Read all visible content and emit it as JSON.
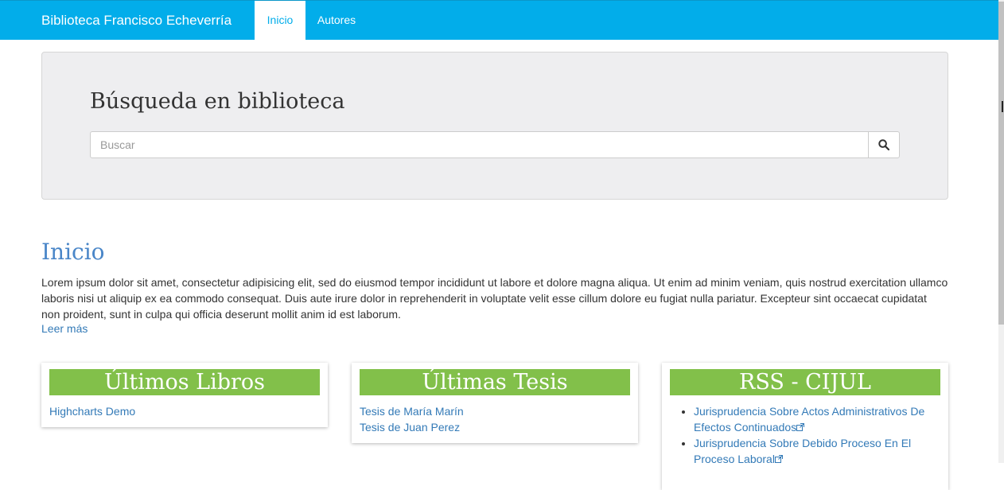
{
  "navbar": {
    "brand": "Biblioteca Francisco Echeverría",
    "items": [
      {
        "label": "Inicio",
        "active": true
      },
      {
        "label": "Autores",
        "active": false
      }
    ],
    "background_color": "#02adea"
  },
  "search": {
    "title": "Búsqueda en biblioteca",
    "placeholder": "Buscar",
    "value": "",
    "button_icon": "search-icon"
  },
  "main": {
    "title": "Inicio",
    "intro": "Lorem ipsum dolor sit amet, consectetur adipisicing elit, sed do eiusmod tempor incididunt ut labore et dolore magna aliqua. Ut enim ad minim veniam, quis nostrud exercitation ullamco laboris nisi ut aliquip ex ea commodo consequat. Duis aute irure dolor in reprehenderit in voluptate velit esse cillum dolore eu fugiat nulla pariatur. Excepteur sint occaecat cupidatat non proident, sunt in culpa qui officia deserunt mollit anim id est laborum.",
    "read_more": "Leer más"
  },
  "panels": {
    "header_color": "#82c04a",
    "books": {
      "title": "Últimos Libros",
      "links": [
        "Highcharts Demo"
      ]
    },
    "theses": {
      "title": "Últimas Tesis",
      "links": [
        "Tesis de María Marín",
        "Tesis de Juan Perez"
      ]
    },
    "rss": {
      "title": "RSS - CIJUL",
      "items": [
        "Jurisprudencia Sobre Actos Administrativos De Efectos Continuados",
        "Jurisprudencia Sobre Debido Proceso En El Proceso Laboral"
      ],
      "item_icon": "external-link-icon"
    }
  }
}
